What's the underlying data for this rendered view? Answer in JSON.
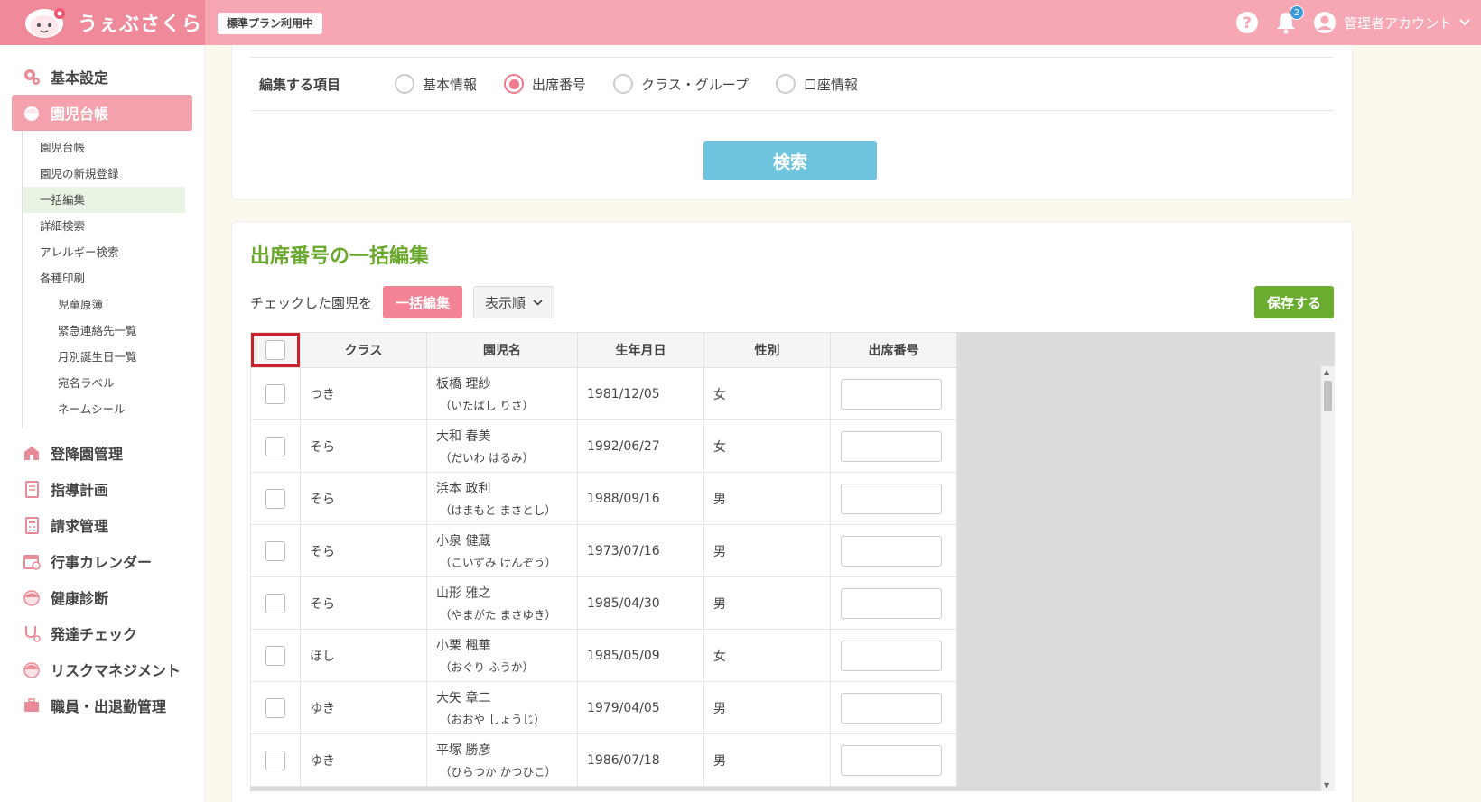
{
  "header": {
    "logo_text": "うぇぶさくら",
    "plan_badge": "標準プラン利用中",
    "notification_count": "2",
    "account_label": "管理者アカウント"
  },
  "sidebar": {
    "top_item": "基本設定",
    "active_item": "園児台帳",
    "sub_items": [
      "園児台帳",
      "園児の新規登録",
      "一括編集",
      "詳細検索",
      "アレルギー検索",
      "各種印刷"
    ],
    "print_items": [
      "児童原簿",
      "緊急連絡先一覧",
      "月別誕生日一覧",
      "宛名ラベル",
      "ネームシール"
    ],
    "other_items": [
      "登降園管理",
      "指導計画",
      "請求管理",
      "行事カレンダー",
      "健康診断",
      "発達チェック",
      "リスクマネジメント",
      "職員・出退勤管理"
    ]
  },
  "filter": {
    "label": "編集する項目",
    "options": [
      "基本情報",
      "出席番号",
      "クラス・グループ",
      "口座情報"
    ],
    "selected": "出席番号",
    "search_button": "検索"
  },
  "bulk": {
    "title": "出席番号の一括編集",
    "checked_label": "チェックした園児を",
    "bulk_edit_button": "一括編集",
    "order_button": "表示順",
    "save_button": "保存する",
    "columns": [
      "クラス",
      "園児名",
      "生年月日",
      "性別",
      "出席番号"
    ],
    "rows": [
      {
        "class": "つき",
        "name": "板橋 理紗",
        "kana": "（いたばし りさ）",
        "birth": "1981/12/05",
        "gender": "女"
      },
      {
        "class": "そら",
        "name": "大和 春美",
        "kana": "（だいわ はるみ）",
        "birth": "1992/06/27",
        "gender": "女"
      },
      {
        "class": "そら",
        "name": "浜本 政利",
        "kana": "（はまもと まさとし）",
        "birth": "1988/09/16",
        "gender": "男"
      },
      {
        "class": "そら",
        "name": "小泉 健蔵",
        "kana": "（こいずみ けんぞう）",
        "birth": "1973/07/16",
        "gender": "男"
      },
      {
        "class": "そら",
        "name": "山形 雅之",
        "kana": "（やまがた まさゆき）",
        "birth": "1985/04/30",
        "gender": "男"
      },
      {
        "class": "ほし",
        "name": "小栗 楓華",
        "kana": "（おぐり ふうか）",
        "birth": "1985/05/09",
        "gender": "女"
      },
      {
        "class": "ゆき",
        "name": "大矢 章二",
        "kana": "（おおや しょうじ）",
        "birth": "1979/04/05",
        "gender": "男"
      },
      {
        "class": "ゆき",
        "name": "平塚 勝彦",
        "kana": "（ひらつか かつひこ）",
        "birth": "1986/07/18",
        "gender": "男"
      }
    ]
  }
}
